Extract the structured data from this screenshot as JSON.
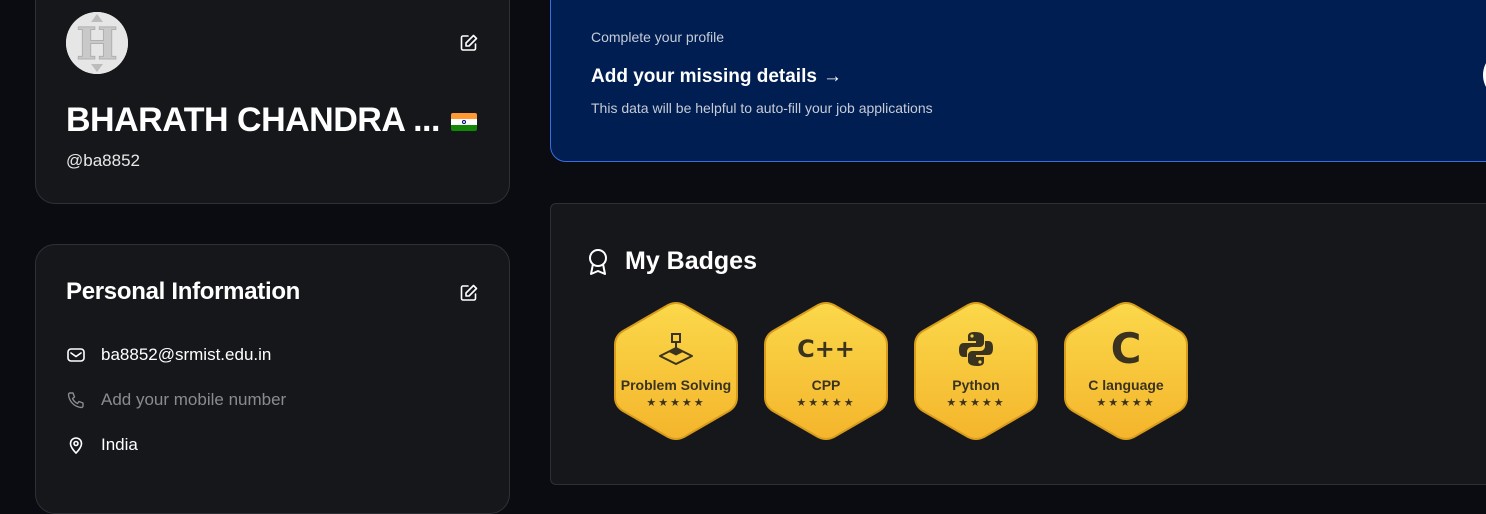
{
  "profile": {
    "name": "BHARATH CHANDRA ...",
    "handle": "@ba8852",
    "avatar_letter": "H",
    "flag_colors": [
      "#ff9933",
      "#ffffff",
      "#138808"
    ]
  },
  "personal_info": {
    "title": "Personal Information",
    "email": "ba8852@srmist.edu.in",
    "mobile_placeholder": "Add your mobile number",
    "country": "India"
  },
  "banner": {
    "kicker": "Complete your profile",
    "cta": "Add your missing details",
    "cta_arrow": "→",
    "description": "This data will be helpful to auto-fill your job applications"
  },
  "badges": {
    "title": "My Badges",
    "items": [
      {
        "label": "Problem Solving",
        "icon": "problem-solving-icon",
        "stars": "★★★★★"
      },
      {
        "label": "CPP",
        "icon": "cpp-icon",
        "glyph": "C++",
        "stars": "★★★★★"
      },
      {
        "label": "Python",
        "icon": "python-icon",
        "stars": "★★★★★"
      },
      {
        "label": "C language",
        "icon": "c-language-icon",
        "glyph": "C",
        "stars": "★★★★★"
      }
    ]
  },
  "colors": {
    "background": "#0b0c12",
    "card": "#16171b",
    "banner_bg": "#001e52",
    "banner_border": "#3b6de0",
    "badge_gold": "#f6c93b"
  }
}
